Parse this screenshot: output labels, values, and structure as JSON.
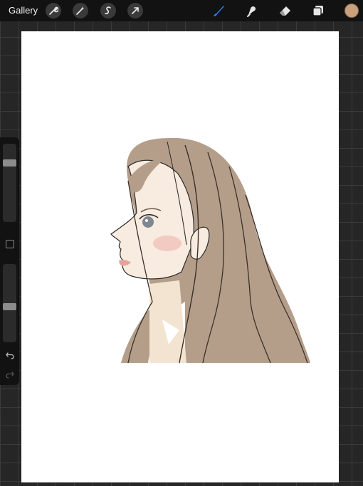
{
  "topbar": {
    "gallery_label": "Gallery",
    "left_tools": [
      {
        "name": "adjust-wrench-icon"
      },
      {
        "name": "magic-wand-icon"
      },
      {
        "name": "selection-s-icon"
      },
      {
        "name": "transform-arrow-icon"
      }
    ],
    "right_tools": [
      {
        "name": "brush-icon",
        "active": true
      },
      {
        "name": "smudge-icon"
      },
      {
        "name": "eraser-icon"
      },
      {
        "name": "layers-icon"
      }
    ],
    "current_color": "#c9a07c",
    "active_color": "#2f7df6"
  },
  "sidebar": {
    "brush_size_level": 0.22,
    "opacity_level": 0.55,
    "modify_button": "square-modify-icon",
    "undo": "undo-icon",
    "redo": "redo-icon"
  },
  "canvas": {
    "background": "#ffffff",
    "artwork": "girl-portrait-illustration",
    "hair_color": "#b49e8a",
    "skin_color": "#f7ecdf"
  }
}
